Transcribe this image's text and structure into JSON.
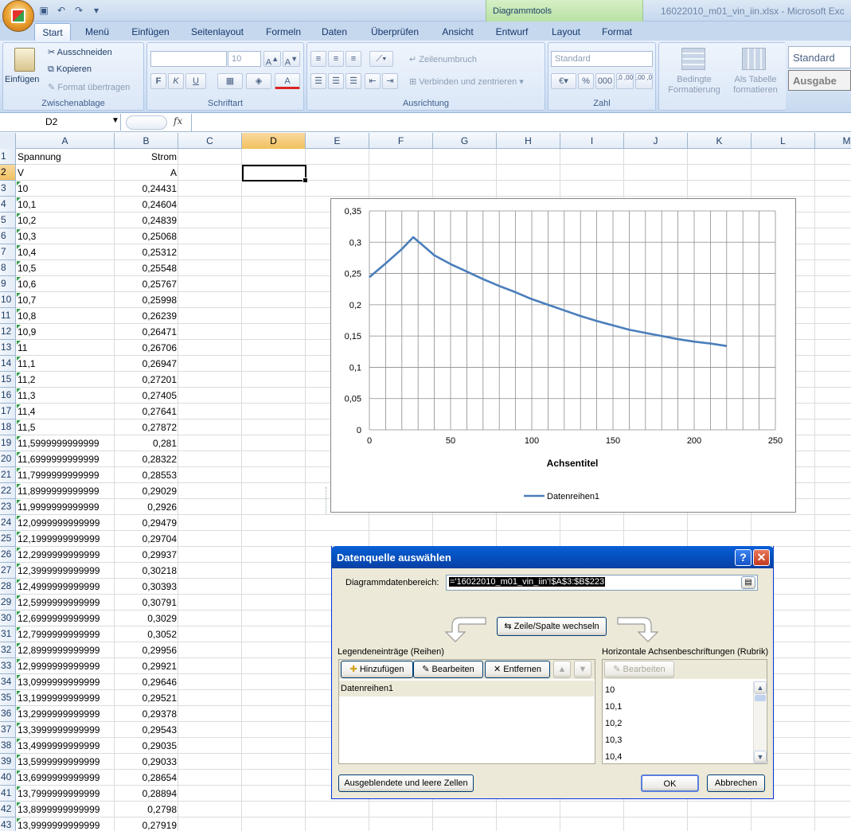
{
  "window": {
    "title": "16022010_m01_vin_iin.xlsx - Microsoft Exc",
    "context_tab_group": "Diagrammtools"
  },
  "tabs": [
    {
      "label": "Start",
      "x": 43,
      "w": 46,
      "active": true
    },
    {
      "label": "Menü",
      "x": 96,
      "w": 52
    },
    {
      "label": "Einfügen",
      "x": 156,
      "w": 66
    },
    {
      "label": "Seitenlayout",
      "x": 230,
      "w": 86
    },
    {
      "label": "Formeln",
      "x": 324,
      "w": 64
    },
    {
      "label": "Daten",
      "x": 396,
      "w": 48
    },
    {
      "label": "Überprüfen",
      "x": 452,
      "w": 88
    },
    {
      "label": "Ansicht",
      "x": 548,
      "w": 54
    },
    {
      "label": "Entwurf",
      "x": 612,
      "w": 62
    },
    {
      "label": "Layout",
      "x": 682,
      "w": 58
    },
    {
      "label": "Format",
      "x": 748,
      "w": 54
    }
  ],
  "ribbon": {
    "clipboard": {
      "label": "Zwischenablage",
      "paste": "Einfügen",
      "cut": "Ausschneiden",
      "copy": "Kopieren",
      "format_painter": "Format übertragen"
    },
    "font": {
      "label": "Schriftart",
      "size": "10",
      "bold": "F",
      "italic": "K",
      "underline": "U"
    },
    "alignment": {
      "label": "Ausrichtung",
      "wrap": "Zeilenumbruch",
      "merge": "Verbinden und zentrieren"
    },
    "number": {
      "label": "Zahl",
      "format": "Standard",
      "percent": "%",
      "thousands": "000",
      "inc_dec": ",0 ,00",
      "dec_dec": ",00 ,0"
    },
    "styles": {
      "conditional": "Bedingte Formatierung",
      "as_table": "Als Tabelle formatieren",
      "style1": "Standard",
      "style2": "Ausgabe"
    }
  },
  "formula_bar": {
    "name_box": "D2",
    "fx": "fx",
    "formula": ""
  },
  "columns": [
    "A",
    "B",
    "C",
    "D",
    "E",
    "F",
    "G",
    "H",
    "I",
    "J",
    "K",
    "L",
    "M"
  ],
  "selected_column": "D",
  "rows": [
    {
      "n": "1",
      "a": "Spannung",
      "b": "Strom"
    },
    {
      "n": "2",
      "a": "V",
      "b": "A"
    },
    {
      "n": "3",
      "a": "10",
      "b": "0,24431"
    },
    {
      "n": "4",
      "a": "10,1",
      "b": "0,24604"
    },
    {
      "n": "5",
      "a": "10,2",
      "b": "0,24839"
    },
    {
      "n": "6",
      "a": "10,3",
      "b": "0,25068"
    },
    {
      "n": "7",
      "a": "10,4",
      "b": "0,25312"
    },
    {
      "n": "8",
      "a": "10,5",
      "b": "0,25548"
    },
    {
      "n": "9",
      "a": "10,6",
      "b": "0,25767"
    },
    {
      "n": "10",
      "a": "10,7",
      "b": "0,25998"
    },
    {
      "n": "11",
      "a": "10,8",
      "b": "0,26239"
    },
    {
      "n": "12",
      "a": "10,9",
      "b": "0,26471"
    },
    {
      "n": "13",
      "a": "11",
      "b": "0,26706"
    },
    {
      "n": "14",
      "a": "11,1",
      "b": "0,26947"
    },
    {
      "n": "15",
      "a": "11,2",
      "b": "0,27201"
    },
    {
      "n": "16",
      "a": "11,3",
      "b": "0,27405"
    },
    {
      "n": "17",
      "a": "11,4",
      "b": "0,27641"
    },
    {
      "n": "18",
      "a": "11,5",
      "b": "0,27872"
    },
    {
      "n": "19",
      "a": "11,5999999999999",
      "b": "0,281"
    },
    {
      "n": "20",
      "a": "11,6999999999999",
      "b": "0,28322"
    },
    {
      "n": "21",
      "a": "11,7999999999999",
      "b": "0,28553"
    },
    {
      "n": "22",
      "a": "11,8999999999999",
      "b": "0,29029"
    },
    {
      "n": "23",
      "a": "11,9999999999999",
      "b": "0,2926"
    },
    {
      "n": "24",
      "a": "12,0999999999999",
      "b": "0,29479"
    },
    {
      "n": "25",
      "a": "12,1999999999999",
      "b": "0,29704"
    },
    {
      "n": "26",
      "a": "12,2999999999999",
      "b": "0,29937"
    },
    {
      "n": "27",
      "a": "12,3999999999999",
      "b": "0,30218"
    },
    {
      "n": "28",
      "a": "12,4999999999999",
      "b": "0,30393"
    },
    {
      "n": "29",
      "a": "12,5999999999999",
      "b": "0,30791"
    },
    {
      "n": "30",
      "a": "12,6999999999999",
      "b": "0,3029"
    },
    {
      "n": "31",
      "a": "12,7999999999999",
      "b": "0,3052"
    },
    {
      "n": "32",
      "a": "12,8999999999999",
      "b": "0,29956"
    },
    {
      "n": "33",
      "a": "12,9999999999999",
      "b": "0,29921"
    },
    {
      "n": "34",
      "a": "13,0999999999999",
      "b": "0,29646"
    },
    {
      "n": "35",
      "a": "13,1999999999999",
      "b": "0,29521"
    },
    {
      "n": "36",
      "a": "13,2999999999999",
      "b": "0,29378"
    },
    {
      "n": "37",
      "a": "13,3999999999999",
      "b": "0,29543"
    },
    {
      "n": "38",
      "a": "13,4999999999999",
      "b": "0,29035"
    },
    {
      "n": "39",
      "a": "13,5999999999999",
      "b": "0,29033"
    },
    {
      "n": "40",
      "a": "13,6999999999999",
      "b": "0,28654"
    },
    {
      "n": "41",
      "a": "13,7999999999999",
      "b": "0,28894"
    },
    {
      "n": "42",
      "a": "13,8999999999999",
      "b": "0,2798"
    },
    {
      "n": "43",
      "a": "13,9999999999999",
      "b": "0,27919"
    }
  ],
  "chart_data": {
    "type": "line",
    "title": "",
    "xlabel": "Achsentitel",
    "ylabel": "",
    "xlim": [
      0,
      250
    ],
    "ylim": [
      0,
      0.35
    ],
    "x_ticks": [
      "0",
      "50",
      "100",
      "150",
      "200",
      "250"
    ],
    "y_ticks": [
      "0",
      "0,05",
      "0,1",
      "0,15",
      "0,2",
      "0,25",
      "0,3",
      "0,35"
    ],
    "grid": true,
    "legend": "bottom",
    "series": [
      {
        "name": "Datenreihen1",
        "color": "#4a7ebb",
        "x": [
          0,
          10,
          20,
          27,
          32,
          40,
          50,
          60,
          70,
          80,
          90,
          100,
          110,
          120,
          130,
          140,
          150,
          160,
          170,
          180,
          190,
          200,
          210,
          220
        ],
        "y": [
          0.244,
          0.266,
          0.289,
          0.308,
          0.297,
          0.279,
          0.265,
          0.253,
          0.241,
          0.23,
          0.22,
          0.209,
          0.2,
          0.191,
          0.182,
          0.174,
          0.167,
          0.16,
          0.155,
          0.15,
          0.145,
          0.141,
          0.138,
          0.134
        ]
      }
    ]
  },
  "dialog": {
    "title": "Datenquelle auswählen",
    "help": "?",
    "range_label": "Diagrammdatenbereich:",
    "range_value": "='16022010_m01_vin_iin'!$A$3:$B$223",
    "switch_button": "Zeile/Spalte wechseln",
    "legend_label": "Legendeneinträge (Reihen)",
    "add": "Hinzufügen",
    "edit": "Bearbeiten",
    "remove": "Entfernen",
    "series_items": [
      "Datenreihen1"
    ],
    "axis_label": "Horizontale Achsenbeschriftungen (Rubrik)",
    "axis_edit": "Bearbeiten",
    "axis_items": [
      "10",
      "10,1",
      "10,2",
      "10,3",
      "10,4"
    ],
    "hidden_button": "Ausgeblendete und leere Zellen",
    "ok": "OK",
    "cancel": "Abbrechen"
  }
}
